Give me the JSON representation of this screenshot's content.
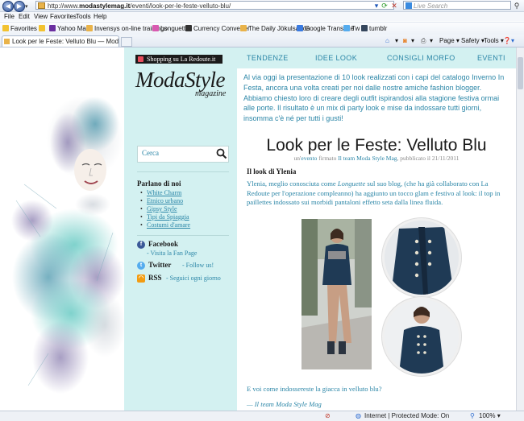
{
  "browser": {
    "url_prefix": "http://www.",
    "url_host": "modastylemag.it",
    "url_path": "/eventi/look-per-le-feste-velluto-blu/",
    "search_placeholder": "Live Search",
    "menu": [
      "File",
      "Edit",
      "View",
      "Favorites",
      "Tools",
      "Help"
    ],
    "favorites_label": "Favorites",
    "favorites": [
      "Yahoo Mail",
      "Invensys on-line trainings",
      "Longuette",
      "Currency Converter",
      "The Daily Jökulsárlón",
      "Google Translate",
      "Tw",
      "tumblr"
    ],
    "tab_title": "Look per le Feste: Velluto Blu — Moda Style Mag...",
    "commands": [
      "Page",
      "Safety",
      "Tools"
    ],
    "status_zone": "Internet | Protected Mode: On",
    "zoom": "100%"
  },
  "sidebar": {
    "shop_label": "Shopping su La Redoute.it",
    "logo_main": "ModaStyle",
    "logo_sub": "magazine",
    "search_placeholder": "Cerca",
    "parlano_title": "Parlano di noi",
    "parlano_items": [
      "White Charm",
      "Etnico urbano",
      "Gipsy Style",
      "Tipi da Spiaggia",
      "Costumi d'amare"
    ],
    "social": [
      {
        "name": "Facebook",
        "note": "- Visita la Fan Page"
      },
      {
        "name": "Twitter",
        "note": "- Follow us!"
      },
      {
        "name": "RSS",
        "note": "- Seguici ogni giorno"
      }
    ]
  },
  "nav": [
    "TENDENZE",
    "IDEE LOOK",
    "CONSIGLI MORFO",
    "EVENTI"
  ],
  "post": {
    "intro": "Al via oggi la presentazione di 10 look realizzati con i capi del catalogo Inverno In Festa, ancora una volta creati per noi dalle nostre amiche fashion blogger. Abbiamo chiesto loro di creare degli outfit ispirandosi alla stagione festiva ormai alle porte. Il risultato è un mix di party look e mise da indossare tutti giorni, insomma c'è né per tutti i gusti!",
    "title": "Look per le Feste: Velluto Blu",
    "meta_prefix": "un'",
    "meta_category": "evento",
    "meta_middle": " firmato ",
    "meta_author": "Il team Moda Style Mag",
    "meta_suffix": ", pubblicato il 21/11/2011",
    "heading": "Il look di Ylenia",
    "body_before": "Ylenia, meglio conosciuta come ",
    "body_blog": "Longuette",
    "body_after": " sul suo blog, (che ha già collaborato con La Redoute per l'operazione compleanno) ha aggiunto un tocco glam e festivo al look: il top in paillettes indossato sui morbidi pantaloni effetto seta dalla linea fluida.",
    "question": "E voi come indossereste la giacca in velluto blu?",
    "signature": "— Il team Moda Style Mag"
  },
  "colors": {
    "accent": "#2b86a7",
    "sidebar_bg": "#d3f1f1",
    "jacket": "#1f3a55"
  }
}
